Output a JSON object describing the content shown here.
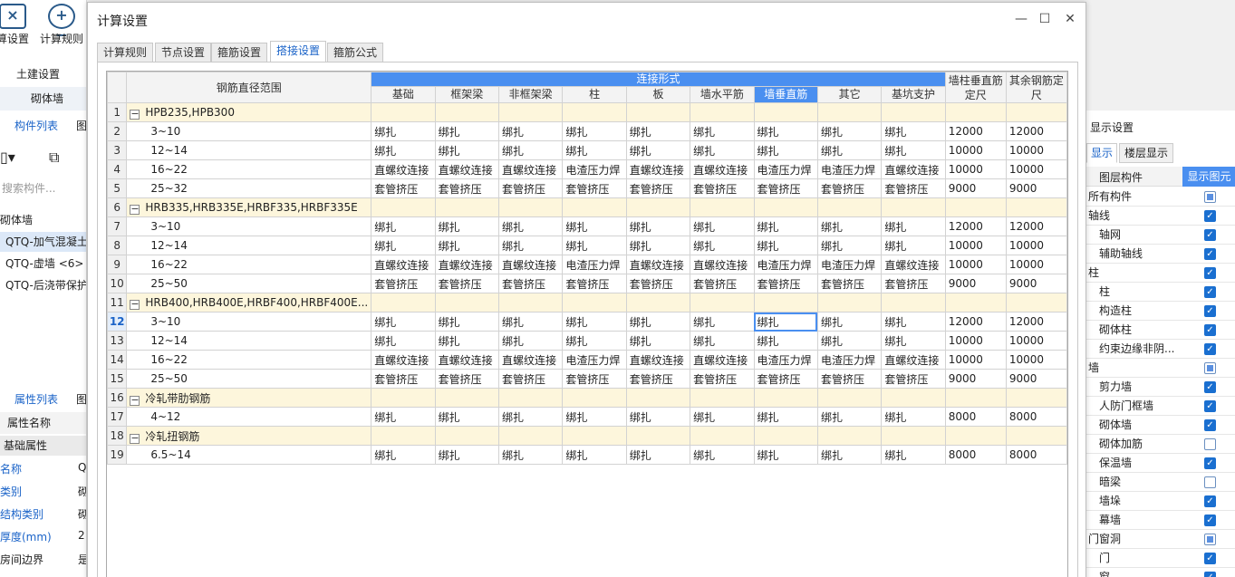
{
  "left": {
    "toolbar": [
      {
        "label": "算设置",
        "icon": "calc-settings-icon",
        "glyph": "×"
      },
      {
        "label": "计算规则",
        "icon": "calc-rules-icon",
        "glyph": "+−"
      }
    ],
    "section": "土建设置",
    "category": "砌体墙",
    "tabs": [
      "构件列表",
      "图"
    ],
    "search_placeholder": "搜索构件...",
    "tree_root": "砌体墙",
    "items": [
      "QTQ-加气混凝土",
      "QTQ-虚墙 <6>",
      "QTQ-后浇带保护"
    ],
    "prop_tabs": [
      "属性列表",
      "图"
    ],
    "prop_header": "属性名称",
    "prop_group": "基础属性",
    "props": [
      {
        "name": "名称",
        "value": "Q"
      },
      {
        "name": "类别",
        "value": "砌"
      },
      {
        "name": "结构类别",
        "value": "砌"
      },
      {
        "name": "厚度(mm)",
        "value": "2"
      },
      {
        "name": "房间边界",
        "value": "是"
      }
    ]
  },
  "right": {
    "title": "显示设置",
    "tabs": [
      "显示",
      "楼层显示"
    ],
    "col_headers": [
      "图层构件",
      "显示图元"
    ],
    "layers": [
      {
        "name": "所有构件",
        "indent": false,
        "state": "part"
      },
      {
        "name": "轴线",
        "indent": false,
        "state": "on"
      },
      {
        "name": "轴网",
        "indent": true,
        "state": "on"
      },
      {
        "name": "辅助轴线",
        "indent": true,
        "state": "on"
      },
      {
        "name": "柱",
        "indent": false,
        "state": "on"
      },
      {
        "name": "柱",
        "indent": true,
        "state": "on"
      },
      {
        "name": "构造柱",
        "indent": true,
        "state": "on"
      },
      {
        "name": "砌体柱",
        "indent": true,
        "state": "on"
      },
      {
        "name": "约束边缘非阴...",
        "indent": true,
        "state": "on"
      },
      {
        "name": "墙",
        "indent": false,
        "state": "part"
      },
      {
        "name": "剪力墙",
        "indent": true,
        "state": "on"
      },
      {
        "name": "人防门框墙",
        "indent": true,
        "state": "on"
      },
      {
        "name": "砌体墙",
        "indent": true,
        "state": "on"
      },
      {
        "name": "砌体加筋",
        "indent": true,
        "state": "off"
      },
      {
        "name": "保温墙",
        "indent": true,
        "state": "on"
      },
      {
        "name": "暗梁",
        "indent": true,
        "state": "off"
      },
      {
        "name": "墙垛",
        "indent": true,
        "state": "on"
      },
      {
        "name": "幕墙",
        "indent": true,
        "state": "on"
      },
      {
        "name": "门窗洞",
        "indent": false,
        "state": "part"
      },
      {
        "name": "门",
        "indent": true,
        "state": "on"
      },
      {
        "name": "窗",
        "indent": true,
        "state": "on"
      }
    ]
  },
  "dialog": {
    "title": "计算设置",
    "window_buttons": {
      "minimize": "—",
      "maximize": "☐",
      "close": "✕"
    },
    "tabs": [
      "计算规则",
      "节点设置",
      "箍筋设置",
      "搭接设置",
      "箍筋公式"
    ],
    "active_tab": 3,
    "table": {
      "range_header": "钢筋直径范围",
      "group_header": "连接形式",
      "columns": [
        "基础",
        "框架梁",
        "非框架梁",
        "柱",
        "板",
        "墙水平筋",
        "墙垂直筋",
        "其它",
        "基坑支护"
      ],
      "selected_column": 6,
      "extra_columns": [
        "墙柱垂直筋定尺",
        "其余钢筋定尺"
      ],
      "current_row": "12",
      "rows": [
        {
          "no": "1",
          "group": true,
          "label": "HPB235,HPB300"
        },
        {
          "no": "2",
          "label": "3~10",
          "cells": [
            "绑扎",
            "绑扎",
            "绑扎",
            "绑扎",
            "绑扎",
            "绑扎",
            "绑扎",
            "绑扎",
            "绑扎",
            "12000",
            "12000"
          ]
        },
        {
          "no": "3",
          "label": "12~14",
          "cells": [
            "绑扎",
            "绑扎",
            "绑扎",
            "绑扎",
            "绑扎",
            "绑扎",
            "绑扎",
            "绑扎",
            "绑扎",
            "10000",
            "10000"
          ]
        },
        {
          "no": "4",
          "label": "16~22",
          "cells": [
            "直螺纹连接",
            "直螺纹连接",
            "直螺纹连接",
            "电渣压力焊",
            "直螺纹连接",
            "直螺纹连接",
            "电渣压力焊",
            "电渣压力焊",
            "直螺纹连接",
            "10000",
            "10000"
          ]
        },
        {
          "no": "5",
          "label": "25~32",
          "cells": [
            "套管挤压",
            "套管挤压",
            "套管挤压",
            "套管挤压",
            "套管挤压",
            "套管挤压",
            "套管挤压",
            "套管挤压",
            "套管挤压",
            "9000",
            "9000"
          ]
        },
        {
          "no": "6",
          "group": true,
          "label": "HRB335,HRB335E,HRBF335,HRBF335E"
        },
        {
          "no": "7",
          "label": "3~10",
          "cells": [
            "绑扎",
            "绑扎",
            "绑扎",
            "绑扎",
            "绑扎",
            "绑扎",
            "绑扎",
            "绑扎",
            "绑扎",
            "12000",
            "12000"
          ]
        },
        {
          "no": "8",
          "label": "12~14",
          "cells": [
            "绑扎",
            "绑扎",
            "绑扎",
            "绑扎",
            "绑扎",
            "绑扎",
            "绑扎",
            "绑扎",
            "绑扎",
            "10000",
            "10000"
          ]
        },
        {
          "no": "9",
          "label": "16~22",
          "cells": [
            "直螺纹连接",
            "直螺纹连接",
            "直螺纹连接",
            "电渣压力焊",
            "直螺纹连接",
            "直螺纹连接",
            "电渣压力焊",
            "电渣压力焊",
            "直螺纹连接",
            "10000",
            "10000"
          ]
        },
        {
          "no": "10",
          "label": "25~50",
          "cells": [
            "套管挤压",
            "套管挤压",
            "套管挤压",
            "套管挤压",
            "套管挤压",
            "套管挤压",
            "套管挤压",
            "套管挤压",
            "套管挤压",
            "9000",
            "9000"
          ]
        },
        {
          "no": "11",
          "group": true,
          "label": "HRB400,HRB400E,HRBF400,HRBF400E..."
        },
        {
          "no": "12",
          "label": "3~10",
          "cells": [
            "绑扎",
            "绑扎",
            "绑扎",
            "绑扎",
            "绑扎",
            "绑扎",
            "绑扎",
            "绑扎",
            "绑扎",
            "12000",
            "12000"
          ]
        },
        {
          "no": "13",
          "label": "12~14",
          "cells": [
            "绑扎",
            "绑扎",
            "绑扎",
            "绑扎",
            "绑扎",
            "绑扎",
            "绑扎",
            "绑扎",
            "绑扎",
            "10000",
            "10000"
          ]
        },
        {
          "no": "14",
          "label": "16~22",
          "cells": [
            "直螺纹连接",
            "直螺纹连接",
            "直螺纹连接",
            "电渣压力焊",
            "直螺纹连接",
            "直螺纹连接",
            "电渣压力焊",
            "电渣压力焊",
            "直螺纹连接",
            "10000",
            "10000"
          ]
        },
        {
          "no": "15",
          "label": "25~50",
          "cells": [
            "套管挤压",
            "套管挤压",
            "套管挤压",
            "套管挤压",
            "套管挤压",
            "套管挤压",
            "套管挤压",
            "套管挤压",
            "套管挤压",
            "9000",
            "9000"
          ]
        },
        {
          "no": "16",
          "group": true,
          "label": "冷轧带肋钢筋"
        },
        {
          "no": "17",
          "label": "4~12",
          "cells": [
            "绑扎",
            "绑扎",
            "绑扎",
            "绑扎",
            "绑扎",
            "绑扎",
            "绑扎",
            "绑扎",
            "绑扎",
            "8000",
            "8000"
          ]
        },
        {
          "no": "18",
          "group": true,
          "label": "冷轧扭钢筋"
        },
        {
          "no": "19",
          "label": "6.5~14",
          "cells": [
            "绑扎",
            "绑扎",
            "绑扎",
            "绑扎",
            "绑扎",
            "绑扎",
            "绑扎",
            "绑扎",
            "绑扎",
            "8000",
            "8000"
          ]
        }
      ]
    }
  }
}
